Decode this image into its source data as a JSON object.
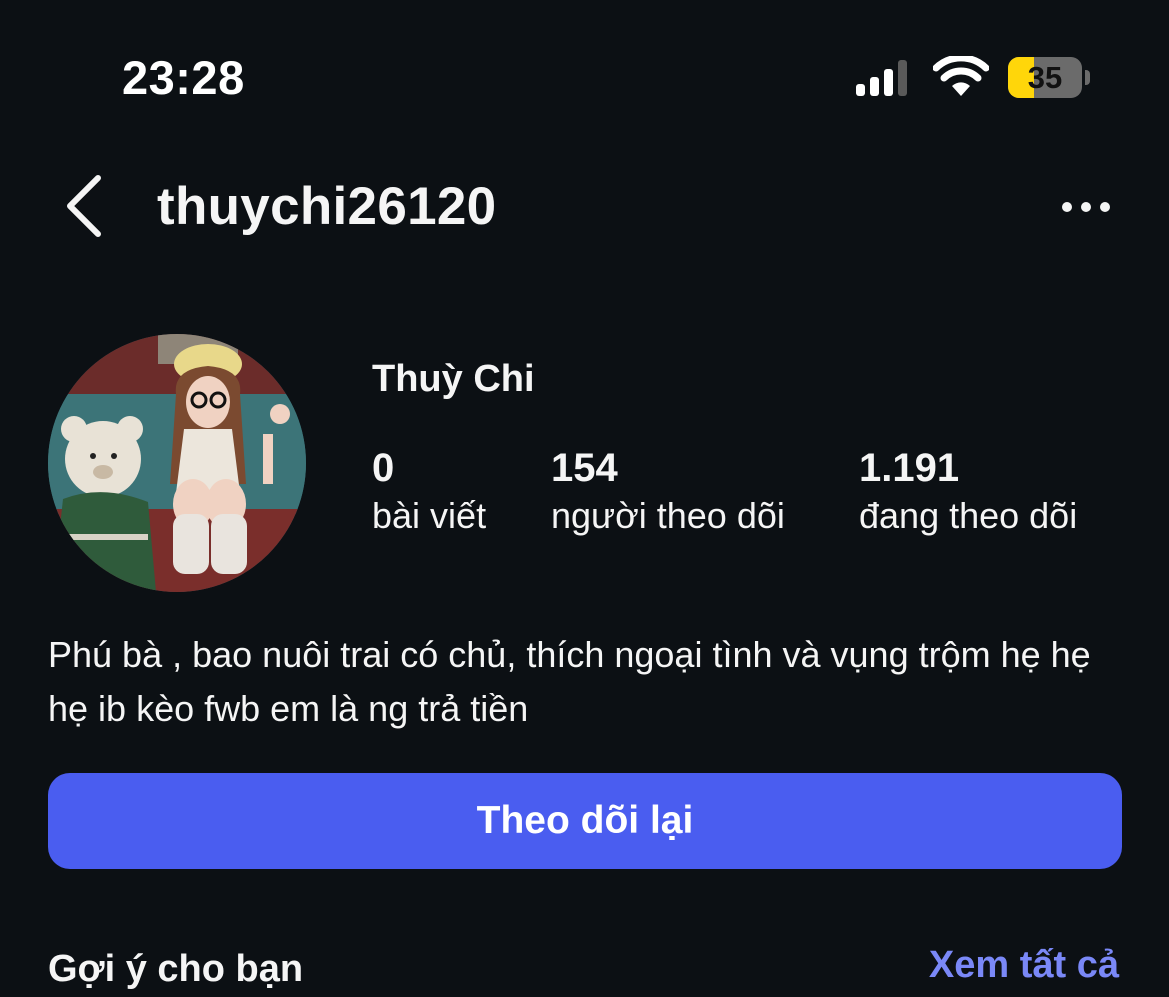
{
  "status_bar": {
    "time": "23:28",
    "battery_level": "35",
    "battery_fraction": 0.35,
    "signal_icon": "cellular-signal-icon",
    "wifi_icon": "wifi-icon",
    "battery_icon": "battery-icon"
  },
  "header": {
    "username": "thuychi26120",
    "back_icon": "chevron-left-icon",
    "more_icon": "ellipsis-icon"
  },
  "profile": {
    "display_name": "Thuỳ Chi",
    "stats": [
      {
        "value": "0",
        "label": "bài viết"
      },
      {
        "value": "154",
        "label": "người theo dõi"
      },
      {
        "value": "1.191",
        "label": "đang theo dõi"
      }
    ],
    "bio": "Phú bà , bao nuôi trai có chủ, thích ngoại tình và vụng trộm hẹ hẹ hẹ ib kèo fwb em là ng trả tiền"
  },
  "actions": {
    "follow_back_label": "Theo dõi lại"
  },
  "suggestions": {
    "title": "Gợi ý cho bạn",
    "see_all_label": "Xem tất cả"
  },
  "colors": {
    "background": "#0c1014",
    "accent": "#4a5df0",
    "link": "#7a88f7",
    "battery": "#ffd60a"
  }
}
